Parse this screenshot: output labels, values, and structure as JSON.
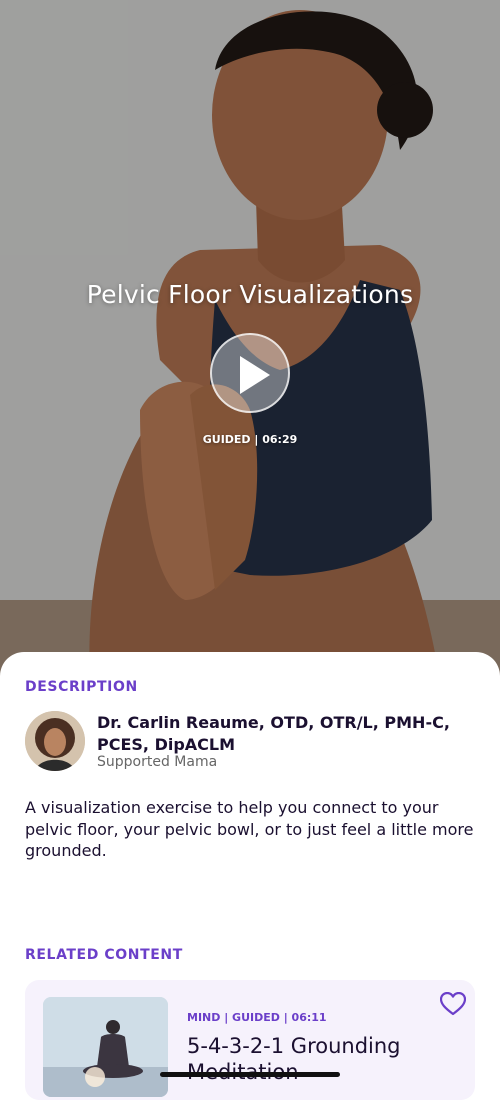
{
  "hero": {
    "title": "Pelvic Floor Visualizations",
    "meta": "GUIDED | 06:29",
    "image": "woman-meditating-hands-together-photo"
  },
  "description_section": {
    "label": "DESCRIPTION",
    "author_name": "Dr. Carlin Reaume, OTD, OTR/L, PMH-C, PCES, DipACLM",
    "author_org": "Supported Mama",
    "text": "A visualization exercise to help you connect to your pelvic floor, your pelvic bowl, or to just feel a little more grounded."
  },
  "related": {
    "label": "RELATED CONTENT",
    "items": [
      {
        "meta": "MIND | GUIDED | 06:11",
        "title": "5-4-3-2-1 Grounding Meditation",
        "icon": "heart-outline-icon"
      }
    ]
  },
  "colors": {
    "accent": "#6b3fc9",
    "card_bg": "#f6f2fc",
    "text": "#1b1030"
  }
}
